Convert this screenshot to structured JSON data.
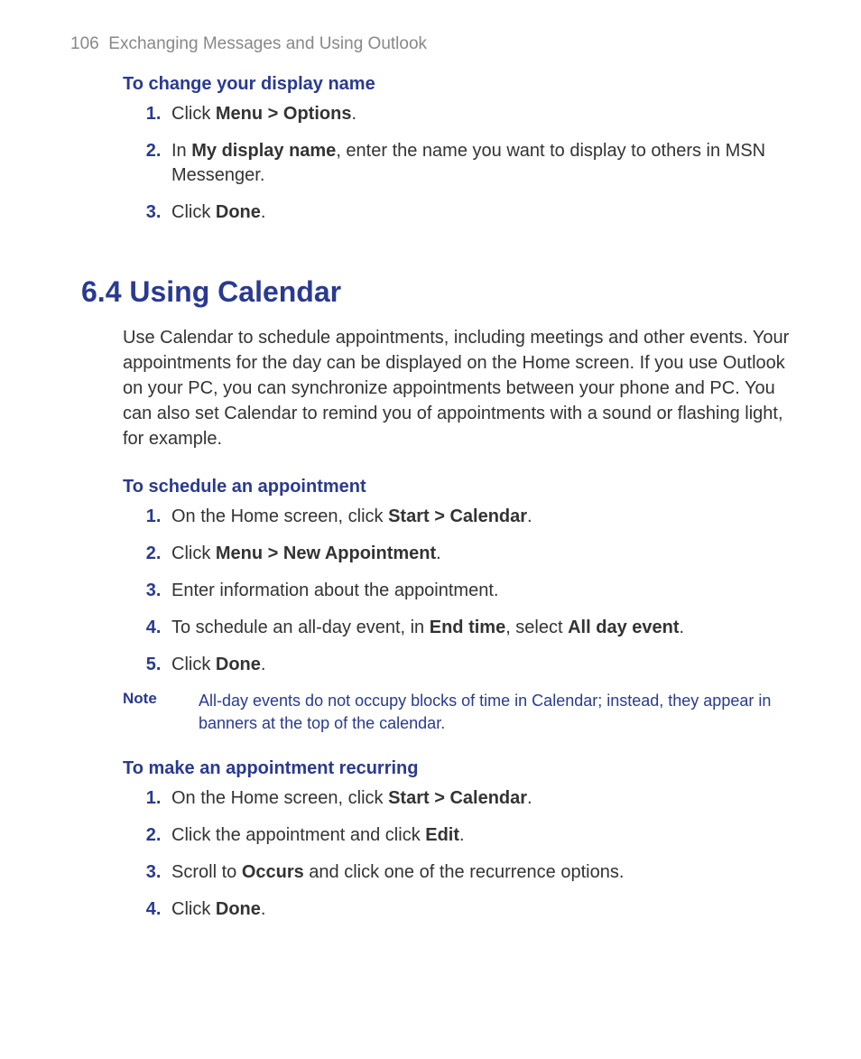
{
  "header": {
    "page_number": "106",
    "chapter_title": "Exchanging Messages and Using Outlook"
  },
  "section1": {
    "subheading": "To change your display name",
    "steps": [
      {
        "pre": "Click ",
        "bold1": "Menu > Options",
        "post": "."
      },
      {
        "pre": "In ",
        "bold1": "My display name",
        "mid": ", enter the name you want to display to others in MSN Messenger."
      },
      {
        "pre": "Click ",
        "bold1": "Done",
        "post": "."
      }
    ]
  },
  "main": {
    "title": "6.4 Using Calendar",
    "paragraph": "Use Calendar to schedule appointments, including meetings and other events. Your appointments for the day can be displayed on the Home screen. If you use Outlook on your PC, you can synchronize appointments between your phone and PC. You can also set Calendar to remind you of appointments with a sound or flashing light, for example."
  },
  "section2": {
    "subheading": "To schedule an appointment",
    "steps": [
      {
        "pre": "On the Home screen, click ",
        "bold1": "Start > Calendar",
        "post": "."
      },
      {
        "pre": "Click ",
        "bold1": "Menu > New Appointment",
        "post": "."
      },
      {
        "pre": "Enter information about the appointment."
      },
      {
        "pre": "To schedule an all-day event, in ",
        "bold1": "End time",
        "mid": ", select ",
        "bold2": "All day event",
        "post": "."
      },
      {
        "pre": "Click ",
        "bold1": "Done",
        "post": "."
      }
    ],
    "note_label": "Note",
    "note_text": "All-day events do not occupy blocks of time in Calendar; instead, they appear in banners at the top of the calendar."
  },
  "section3": {
    "subheading": "To make an appointment recurring",
    "steps": [
      {
        "pre": "On the Home screen, click ",
        "bold1": "Start > Calendar",
        "post": "."
      },
      {
        "pre": "Click the appointment and click ",
        "bold1": "Edit",
        "post": "."
      },
      {
        "pre": "Scroll to ",
        "bold1": "Occurs",
        "mid": " and click one of the recurrence options."
      },
      {
        "pre": "Click ",
        "bold1": "Done",
        "post": "."
      }
    ]
  }
}
